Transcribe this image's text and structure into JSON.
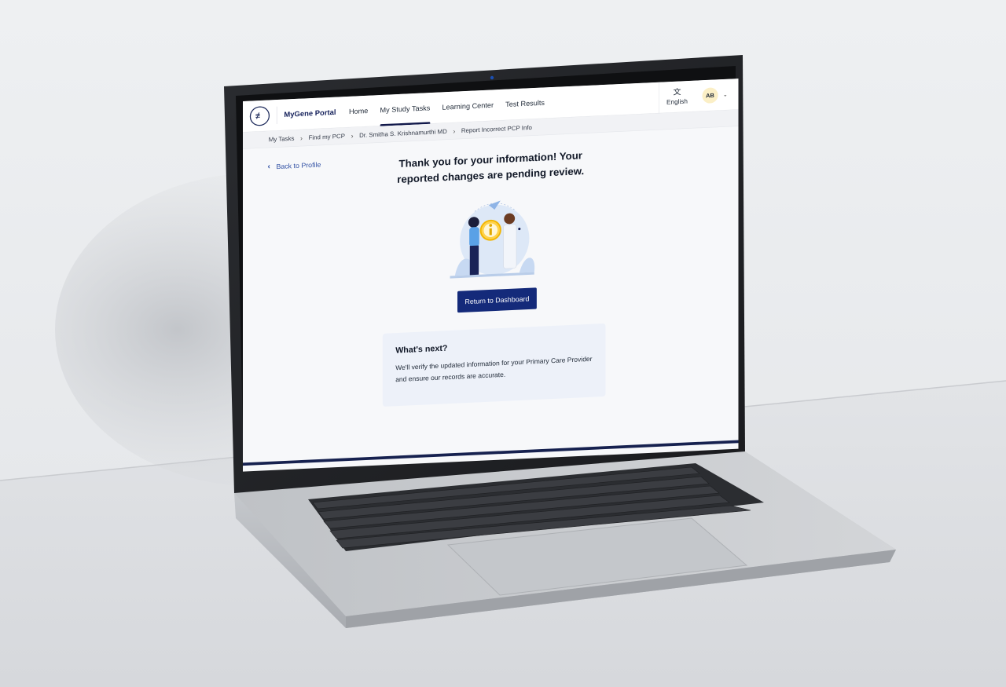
{
  "header": {
    "brand": "MyGene Portal",
    "nav": [
      {
        "label": "Home",
        "active": false
      },
      {
        "label": "My Study Tasks",
        "active": true
      },
      {
        "label": "Learning Center",
        "active": false
      },
      {
        "label": "Test Results",
        "active": false
      }
    ],
    "language_label": "English",
    "avatar_initials": "AB"
  },
  "breadcrumb": [
    "My Tasks",
    "Find my PCP",
    "Dr. Smitha S. Krishnamurthi MD",
    "Report Incorrect PCP Info"
  ],
  "main": {
    "back_label": "Back to Profile",
    "heading": "Thank you for your information! Your reported changes are pending review.",
    "cta_label": "Return to Dashboard",
    "next": {
      "title": "What's next?",
      "body": "We'll verify the updated information for your Primary Care Provider and ensure our records are accurate."
    }
  },
  "colors": {
    "brand_navy": "#142a7a",
    "nav_underline": "#11184a",
    "link_blue": "#2f4fa3",
    "card_bg": "#edf1f9",
    "avatar_bg": "#fbefc6"
  }
}
